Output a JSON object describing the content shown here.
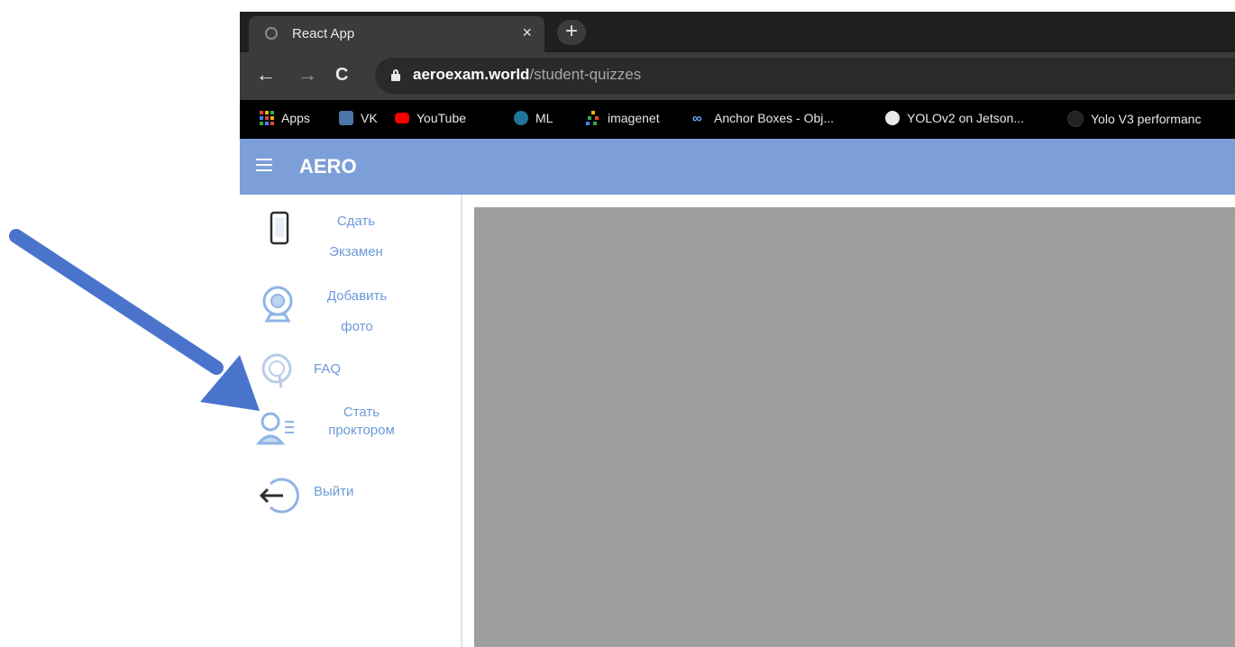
{
  "browser": {
    "tab_title": "React App",
    "tab_close": "×",
    "new_tab": "+",
    "nav": {
      "back": "←",
      "forward": "→",
      "reload": "C"
    },
    "url": {
      "host": "aeroexam.world",
      "path": "/student-quizzes"
    },
    "bookmarks": [
      {
        "label": "Apps",
        "icon": "apps-grid-icon",
        "color": "#e8453c"
      },
      {
        "label": "VK",
        "icon": "vk-icon",
        "color": "#4a76a8"
      },
      {
        "label": "YouTube",
        "icon": "youtube-icon",
        "color": "#ff0000"
      },
      {
        "label": "ML",
        "icon": "wordpress-icon",
        "color": "#21759b"
      },
      {
        "label": "imagenet",
        "icon": "imagenet-icon",
        "color": "#f4b400"
      },
      {
        "label": "Anchor Boxes - Obj...",
        "icon": "infinity-icon",
        "color": "#6fa8ff"
      },
      {
        "label": "YOLOv2 on Jetson...",
        "icon": "globe-icon",
        "color": "#e8e8e8"
      },
      {
        "label": "Yolo V3 performanc",
        "icon": "github-icon",
        "color": "#222222"
      }
    ]
  },
  "app": {
    "brand": "AERO",
    "accent": "#7d9fd9",
    "sidebar": [
      {
        "label": "Сдать Экзамен",
        "icon": "phone-icon"
      },
      {
        "label": "Добавить фото",
        "icon": "webcam-icon"
      },
      {
        "label": "FAQ",
        "icon": "faq-icon"
      },
      {
        "label": "Стать проктором",
        "icon": "proctor-icon"
      },
      {
        "label": "Выйти",
        "icon": "logout-icon"
      }
    ],
    "sidebar_label_color": "#6c9ad8",
    "content_color": "#9e9e9e"
  },
  "annotation": {
    "arrow_color": "#4a74cc"
  }
}
